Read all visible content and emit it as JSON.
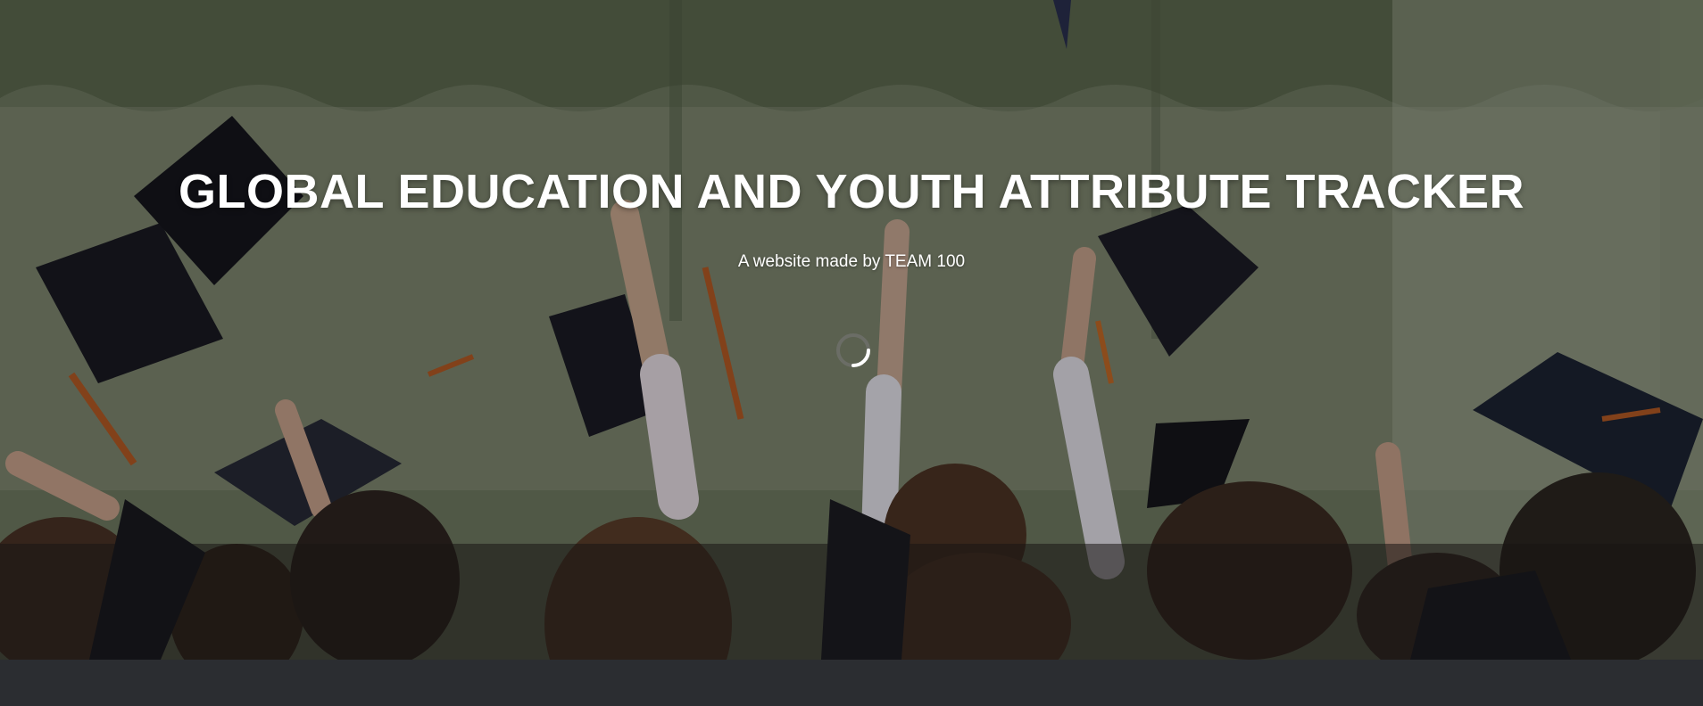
{
  "hero": {
    "title": "GLOBAL EDUCATION AND YOUTH ATTRIBUTE TRACKER",
    "subtitle": "A website made by TEAM 100",
    "background": "graduation-caps-photo",
    "loading_indicator": "spinner-icon"
  },
  "colors": {
    "text": "#ffffff",
    "footer": "#2b2d31",
    "overlay": "#000000"
  }
}
